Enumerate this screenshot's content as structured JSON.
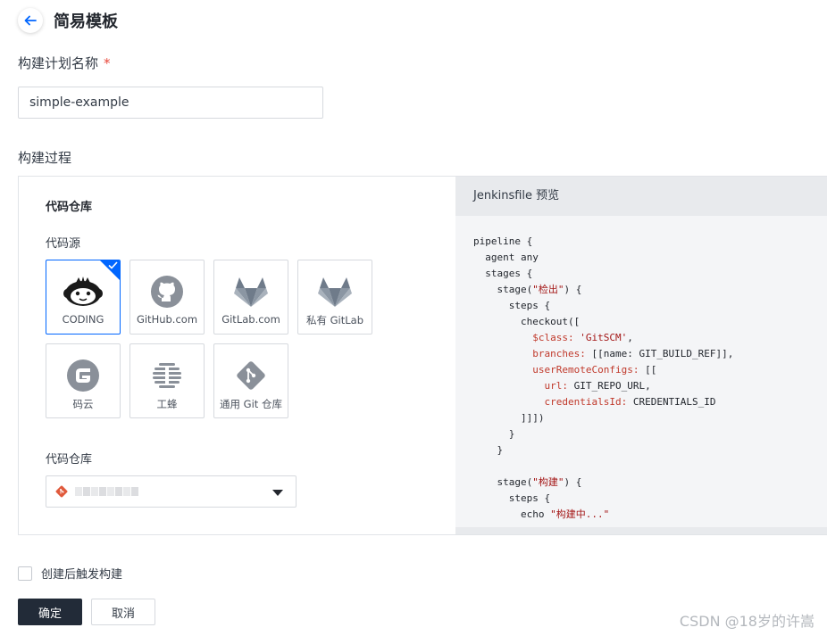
{
  "header": {
    "title": "简易模板",
    "back_icon": "arrow-left-icon"
  },
  "plan_name": {
    "label": "构建计划名称",
    "required_mark": "*",
    "value": "simple-example"
  },
  "build_process": {
    "label": "构建过程",
    "repository_section": {
      "title": "代码仓库",
      "source_label": "代码源",
      "sources": [
        {
          "name": "CODING",
          "icon": "coding-monkey-icon",
          "selected": true
        },
        {
          "name": "GitHub.com",
          "icon": "github-icon",
          "selected": false
        },
        {
          "name": "GitLab.com",
          "icon": "gitlab-icon",
          "selected": false
        },
        {
          "name": "私有 GitLab",
          "icon": "gitlab-icon",
          "selected": false
        },
        {
          "name": "码云",
          "icon": "gitee-icon",
          "selected": false
        },
        {
          "name": "工蜂",
          "icon": "gongfeng-icon",
          "selected": false
        },
        {
          "name": "通用 Git 仓库",
          "icon": "git-icon",
          "selected": false
        }
      ],
      "repo_label": "代码仓库",
      "repo_icon": "git-repo-icon"
    },
    "jenkinsfile": {
      "title": "Jenkinsfile 预览",
      "lines": [
        [
          {
            "t": "pipeline {"
          }
        ],
        [
          {
            "t": "  agent any"
          }
        ],
        [
          {
            "t": "  stages {"
          }
        ],
        [
          {
            "t": "    stage("
          },
          {
            "t": "\"检出\"",
            "c": "s"
          },
          {
            "t": ") {"
          }
        ],
        [
          {
            "t": "      steps {"
          }
        ],
        [
          {
            "t": "        checkout(["
          }
        ],
        [
          {
            "t": "          "
          },
          {
            "t": "$class:",
            "c": "k"
          },
          {
            "t": " "
          },
          {
            "t": "'GitSCM'",
            "c": "s"
          },
          {
            "t": ","
          }
        ],
        [
          {
            "t": "          "
          },
          {
            "t": "branches:",
            "c": "k"
          },
          {
            "t": " [[name: GIT_BUILD_REF]],"
          }
        ],
        [
          {
            "t": "          "
          },
          {
            "t": "userRemoteConfigs:",
            "c": "k"
          },
          {
            "t": " [["
          }
        ],
        [
          {
            "t": "            "
          },
          {
            "t": "url:",
            "c": "k"
          },
          {
            "t": " GIT_REPO_URL,"
          }
        ],
        [
          {
            "t": "            "
          },
          {
            "t": "credentialsId:",
            "c": "k"
          },
          {
            "t": " CREDENTIALS_ID"
          }
        ],
        [
          {
            "t": "        ]]])"
          }
        ],
        [
          {
            "t": "      }"
          }
        ],
        [
          {
            "t": "    }"
          }
        ],
        [
          {
            "t": ""
          }
        ],
        [
          {
            "t": "    stage("
          },
          {
            "t": "\"构建\"",
            "c": "s"
          },
          {
            "t": ") {"
          }
        ],
        [
          {
            "t": "      steps {"
          }
        ],
        [
          {
            "t": "        echo "
          },
          {
            "t": "\"构建中...\"",
            "c": "s"
          }
        ]
      ]
    }
  },
  "trigger_after_create": {
    "label": "创建后触发构建",
    "checked": false
  },
  "actions": {
    "confirm": "确定",
    "cancel": "取消"
  },
  "watermark": "CSDN @18岁的许嵩",
  "colors": {
    "primary": "#222b38",
    "accent": "#0066ff",
    "required": "#e8483b"
  }
}
